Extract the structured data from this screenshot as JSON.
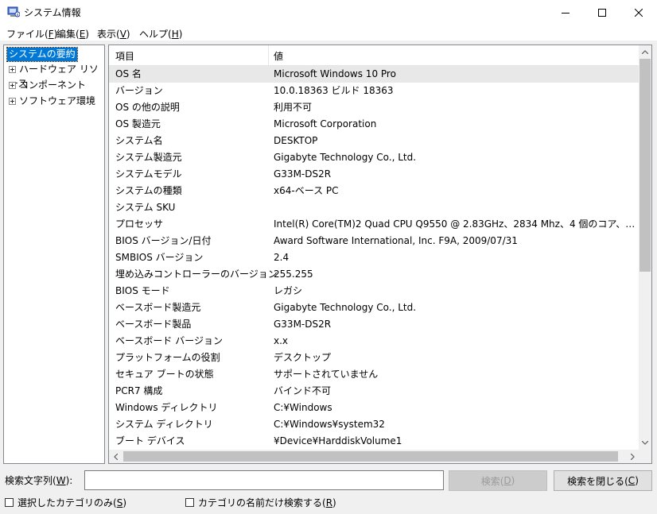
{
  "window": {
    "title": "システム情報",
    "app_icon": "system-information-icon",
    "minimize_icon": "minimize-icon",
    "maximize_icon": "maximize-icon",
    "close_icon": "close-icon"
  },
  "menu": [
    {
      "label": "ファイル(",
      "mnemonic": "F",
      "tail": ")"
    },
    {
      "label": "編集(",
      "mnemonic": "E",
      "tail": ")"
    },
    {
      "label": "表示(",
      "mnemonic": "V",
      "tail": ")"
    },
    {
      "label": "ヘルプ(",
      "mnemonic": "H",
      "tail": ")"
    }
  ],
  "tree": {
    "root": "システムの要約",
    "children": [
      "ハードウェア リソース",
      "コンポーネント",
      "ソフトウェア環境"
    ],
    "expander_icon": "plus-expander-icon"
  },
  "list": {
    "headers": {
      "item": "項目",
      "value": "値"
    },
    "selected_index": 0,
    "rows": [
      {
        "name": "OS 名",
        "value": "Microsoft Windows 10 Pro"
      },
      {
        "name": "バージョン",
        "value": "10.0.18363 ビルド 18363"
      },
      {
        "name": "OS の他の説明",
        "value": "利用不可"
      },
      {
        "name": "OS 製造元",
        "value": "Microsoft Corporation"
      },
      {
        "name": "システム名",
        "value": "DESKTOP"
      },
      {
        "name": "システム製造元",
        "value": "Gigabyte Technology Co., Ltd."
      },
      {
        "name": "システムモデル",
        "value": "G33M-DS2R"
      },
      {
        "name": "システムの種類",
        "value": "x64-ベース PC"
      },
      {
        "name": "システム SKU",
        "value": ""
      },
      {
        "name": "プロセッサ",
        "value": "Intel(R) Core(TM)2 Quad CPU    Q9550  @ 2.83GHz、2834 Mhz、4 個のコア、4 …"
      },
      {
        "name": "BIOS バージョン/日付",
        "value": "Award Software International, Inc. F9A, 2009/07/31"
      },
      {
        "name": "SMBIOS バージョン",
        "value": "2.4"
      },
      {
        "name": "埋め込みコントローラーのバージョン",
        "value": "255.255"
      },
      {
        "name": "BIOS モード",
        "value": "レガシ"
      },
      {
        "name": "ベースボード製造元",
        "value": "Gigabyte Technology Co., Ltd."
      },
      {
        "name": "ベースボード製品",
        "value": "G33M-DS2R"
      },
      {
        "name": "ベースボード バージョン",
        "value": "x.x"
      },
      {
        "name": "プラットフォームの役割",
        "value": "デスクトップ"
      },
      {
        "name": "セキュア ブートの状態",
        "value": "サポートされていません"
      },
      {
        "name": "PCR7 構成",
        "value": "バインド不可"
      },
      {
        "name": "Windows ディレクトリ",
        "value": "C:¥Windows"
      },
      {
        "name": "システム ディレクトリ",
        "value": "C:¥Windows¥system32"
      },
      {
        "name": "ブート デバイス",
        "value": "¥Device¥HarddiskVolume1"
      }
    ]
  },
  "search": {
    "label": "検索文字列(",
    "label_mnemonic": "W",
    "label_tail": "):",
    "input_value": "",
    "search_button": "検索(",
    "search_button_mnemonic": "D",
    "search_button_tail": ")",
    "close_button": "検索を閉じる(",
    "close_button_mnemonic": "C",
    "close_button_tail": ")"
  },
  "options": {
    "selected_category_only": {
      "label": "選択したカテゴリのみ(",
      "mnemonic": "S",
      "tail": ")",
      "checked": false
    },
    "category_names_only": {
      "label": "カテゴリの名前だけ検索する(",
      "mnemonic": "R",
      "tail": ")",
      "checked": false
    }
  }
}
